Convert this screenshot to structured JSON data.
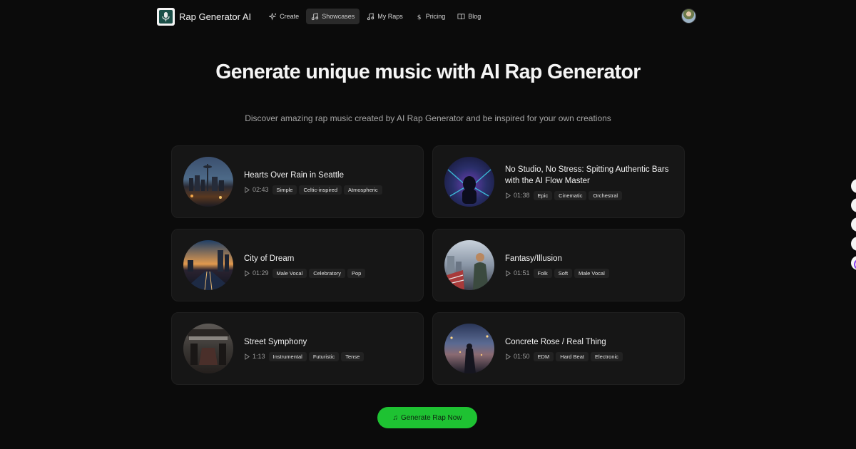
{
  "brand": {
    "name": "Rap Generator AI"
  },
  "nav": {
    "items": [
      {
        "label": "Create",
        "icon": "sparkles-icon",
        "active": false
      },
      {
        "label": "Showcases",
        "icon": "music-note-icon",
        "active": true
      },
      {
        "label": "My Raps",
        "icon": "music-note-icon",
        "active": false
      },
      {
        "label": "Pricing",
        "icon": "dollar-icon",
        "active": false
      },
      {
        "label": "Blog",
        "icon": "book-icon",
        "active": false
      }
    ]
  },
  "hero": {
    "title": "Generate unique music with AI Rap Generator",
    "subtitle": "Discover amazing rap music created by AI Rap Generator and be inspired for your own creations"
  },
  "cards": [
    {
      "title": "Hearts Over Rain in Seattle",
      "duration": "02:43",
      "tags": [
        "Simple",
        "Celtic-inspired",
        "Atmospheric"
      ]
    },
    {
      "title": "No Studio, No Stress: Spitting Authentic Bars with the AI Flow Master",
      "duration": "01:38",
      "tags": [
        "Epic",
        "Cinematic",
        "Orchestral"
      ]
    },
    {
      "title": "City of Dream",
      "duration": "01:29",
      "tags": [
        "Male Vocal",
        "Celebratory",
        "Pop"
      ]
    },
    {
      "title": "Fantasy/Illusion",
      "duration": "01:51",
      "tags": [
        "Folk",
        "Soft",
        "Male Vocal"
      ]
    },
    {
      "title": "Street Symphony",
      "duration": "1:13",
      "tags": [
        "Instrumental",
        "Futuristic",
        "Tense"
      ]
    },
    {
      "title": "Concrete Rose / Real Thing",
      "duration": "01:50",
      "tags": [
        "EDM",
        "Hard Beat",
        "Electronic"
      ]
    }
  ],
  "cta": {
    "label": "Generate Rap Now",
    "icon": "music-note-icon"
  },
  "colors": {
    "background": "#0b0b0b",
    "card": "#161616",
    "accent": "#1ec232",
    "tag": "#222222"
  }
}
